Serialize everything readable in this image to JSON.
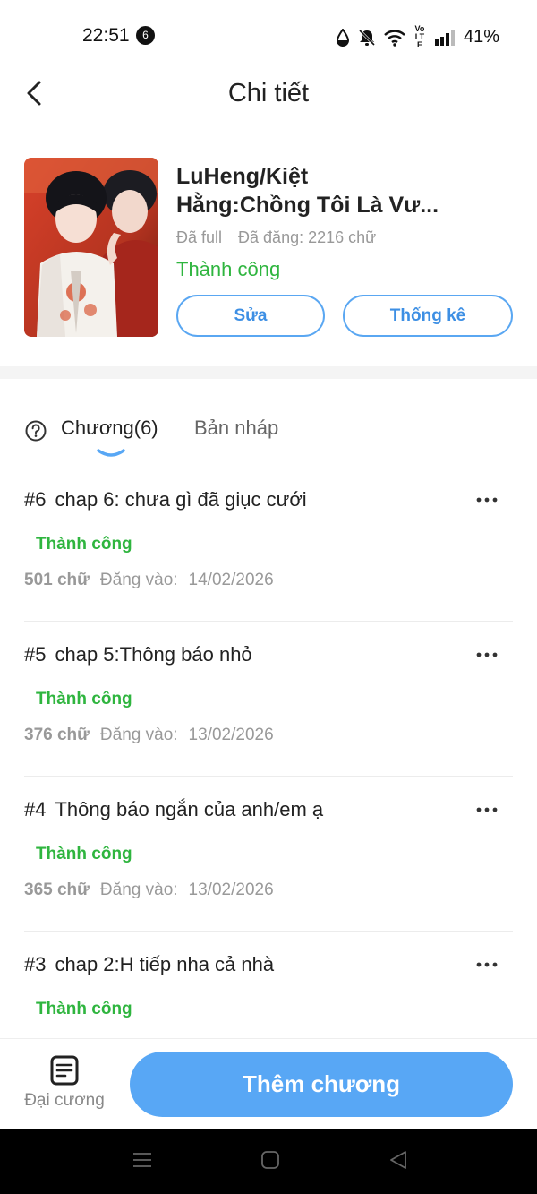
{
  "status_bar": {
    "time": "22:51",
    "notification_count": "6",
    "network": "Vo LTE",
    "battery": "41%"
  },
  "header": {
    "title": "Chi tiết"
  },
  "book": {
    "title_line1": "LuHeng/Kiệt",
    "title_line2": "Hằng:Chồng Tôi Là Vư...",
    "completion": "Đã full",
    "posted": "Đã đăng: 2216 chữ",
    "status": "Thành công",
    "edit_label": "Sửa",
    "stats_label": "Thống kê"
  },
  "tabs": [
    {
      "label": "Chương(6)",
      "active": true
    },
    {
      "label": "Bản nháp",
      "active": false
    }
  ],
  "chapters": [
    {
      "number": "#6",
      "title": "chap 6: chưa gì đã giục cưới",
      "status": "Thành công",
      "words": "501 chữ",
      "posted_label": "Đăng vào:",
      "date": "14/02/2026"
    },
    {
      "number": "#5",
      "title": "chap 5:Thông báo nhỏ",
      "status": "Thành công",
      "words": "376 chữ",
      "posted_label": "Đăng vào:",
      "date": "13/02/2026"
    },
    {
      "number": "#4",
      "title": "Thông báo ngắn của anh/em ạ",
      "status": "Thành công",
      "words": "365 chữ",
      "posted_label": "Đăng vào:",
      "date": "13/02/2026"
    },
    {
      "number": "#3",
      "title": "chap 2:H tiếp nha cả nhà",
      "status": "Thành công",
      "words": "",
      "posted_label": "",
      "date": ""
    }
  ],
  "bottom": {
    "outline_label": "Đại cương",
    "add_label": "Thêm chương"
  },
  "colors": {
    "accent_blue": "#58a7f5",
    "success_green": "#2fb53f",
    "muted_text": "#999999"
  }
}
